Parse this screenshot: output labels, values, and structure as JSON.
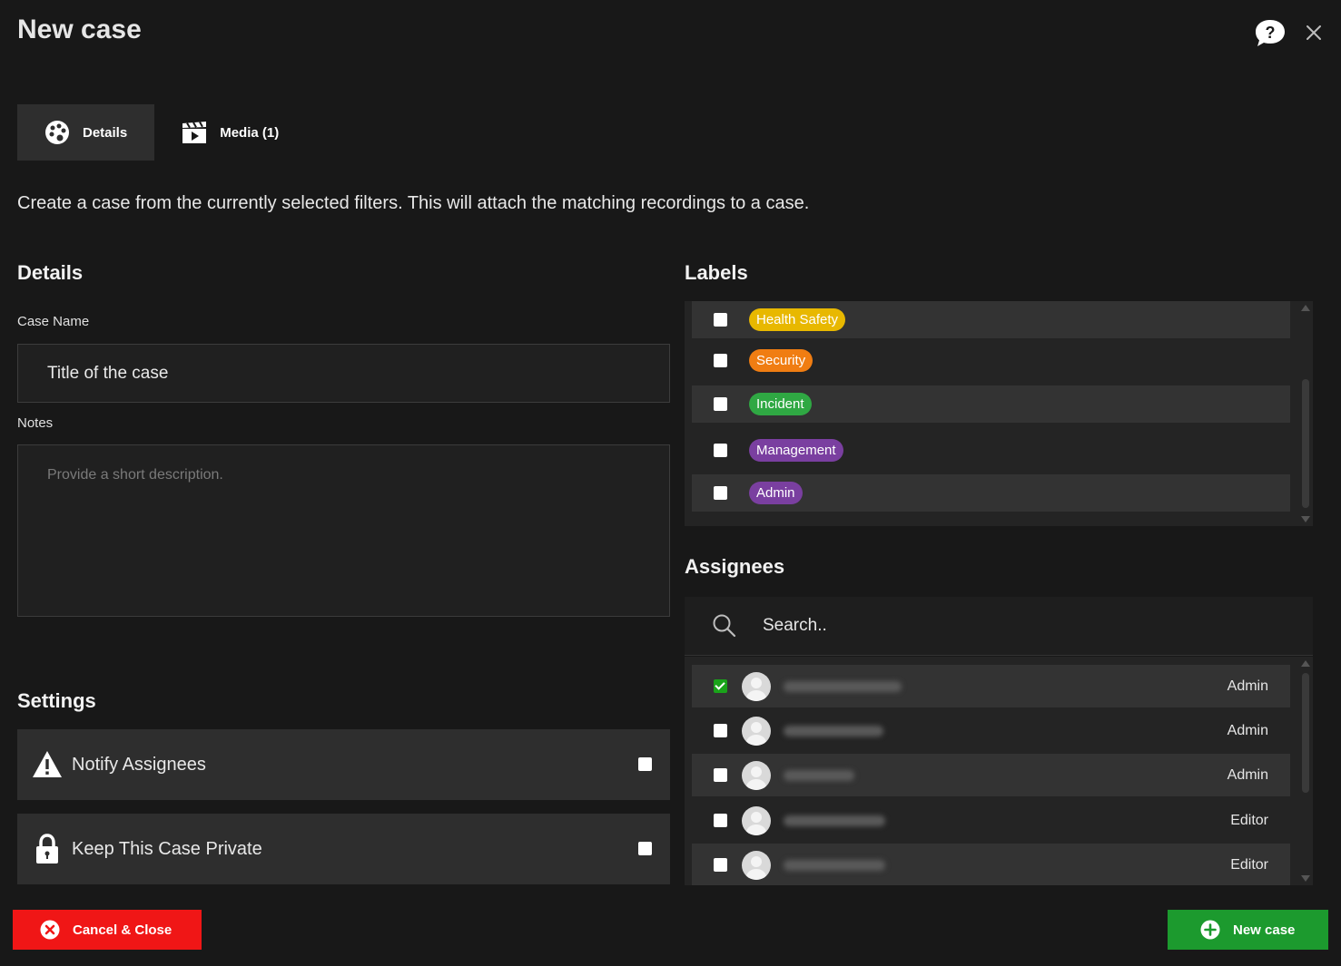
{
  "header": {
    "title": "New case",
    "help_icon": "help-bubble-icon",
    "close_icon": "close-icon"
  },
  "tabs": [
    {
      "label": "Details",
      "icon": "palette-icon",
      "active": true
    },
    {
      "label": "Media (1)",
      "icon": "clapperboard-icon",
      "active": false
    }
  ],
  "intro": "Create a case from the currently selected filters. This will attach the matching recordings to a case.",
  "details": {
    "heading": "Details",
    "case_name_label": "Case Name",
    "case_name_value": "Title of the case",
    "notes_label": "Notes",
    "notes_placeholder": "Provide a short description."
  },
  "settings": {
    "heading": "Settings",
    "items": [
      {
        "label": "Notify Assignees",
        "icon": "warning-icon",
        "checked": false
      },
      {
        "label": "Keep This Case Private",
        "icon": "lock-icon",
        "checked": false
      }
    ]
  },
  "labels": {
    "heading": "Labels",
    "items": [
      {
        "name": "Health Safety",
        "color": "#e8b800",
        "checked": false
      },
      {
        "name": "Security",
        "color": "#f07d12",
        "checked": false
      },
      {
        "name": "Incident",
        "color": "#2fa843",
        "checked": false
      },
      {
        "name": "Management",
        "color": "#7a3fa0",
        "checked": false
      },
      {
        "name": "Admin",
        "color": "#7a3fa0",
        "checked": false
      }
    ]
  },
  "assignees": {
    "heading": "Assignees",
    "search_placeholder": "Search..",
    "items": [
      {
        "role": "Admin",
        "checked": true
      },
      {
        "role": "Admin",
        "checked": false
      },
      {
        "role": "Admin",
        "checked": false
      },
      {
        "role": "Editor",
        "checked": false
      },
      {
        "role": "Editor",
        "checked": false
      }
    ]
  },
  "footer": {
    "cancel_label": "Cancel & Close",
    "new_case_label": "New case"
  },
  "colors": {
    "background": "#181818",
    "cancel": "#f01616",
    "confirm": "#1c9a2e",
    "checked": "#1aa31a"
  }
}
